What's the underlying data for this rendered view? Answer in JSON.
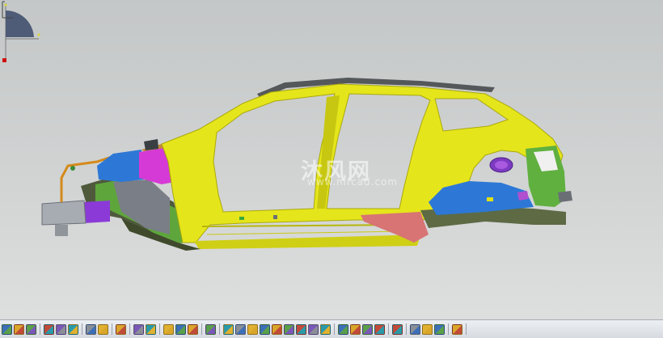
{
  "watermark": {
    "brand": "沐风网",
    "url": "www.mfcad.com"
  },
  "toolbar": {
    "groups": [
      [
        "paint-icon",
        "save-icon",
        "print-icon"
      ],
      [
        "cut-icon",
        "copy-icon",
        "paste-icon"
      ],
      [
        "undo-icon",
        "redo-icon"
      ],
      [
        "whats-this-icon"
      ],
      [
        "formula-icon",
        "knowledge-icon"
      ],
      [
        "catalog-icon",
        "tree-icon",
        "analysis-icon"
      ],
      [
        "sketch-icon"
      ],
      [
        "pan-icon",
        "rotate-icon",
        "zoom-in-icon",
        "zoom-out-icon",
        "normal-view-icon",
        "fit-all-icon",
        "multi-view-icon",
        "iso-view-icon",
        "front-view-icon"
      ],
      [
        "shading-icon",
        "hide-show-icon",
        "swap-space-icon",
        "lights-icon"
      ],
      [
        "measure-icon"
      ],
      [
        "apply-material-icon",
        "render-icon",
        "photo-studio-icon"
      ],
      [
        "capture-icon"
      ]
    ]
  },
  "colors": {
    "body_yellow": "#e6e61c",
    "body_yellow_dark": "#b8b810",
    "blue": "#2a76d2",
    "magenta": "#d63ad6",
    "purple": "#8a3ad2",
    "green": "#5aa83a",
    "dark_olive": "#5a6a3a",
    "pink": "#d87070",
    "gray_metal": "#8a8f96",
    "toolbar_bg": "#e4e7eb"
  }
}
